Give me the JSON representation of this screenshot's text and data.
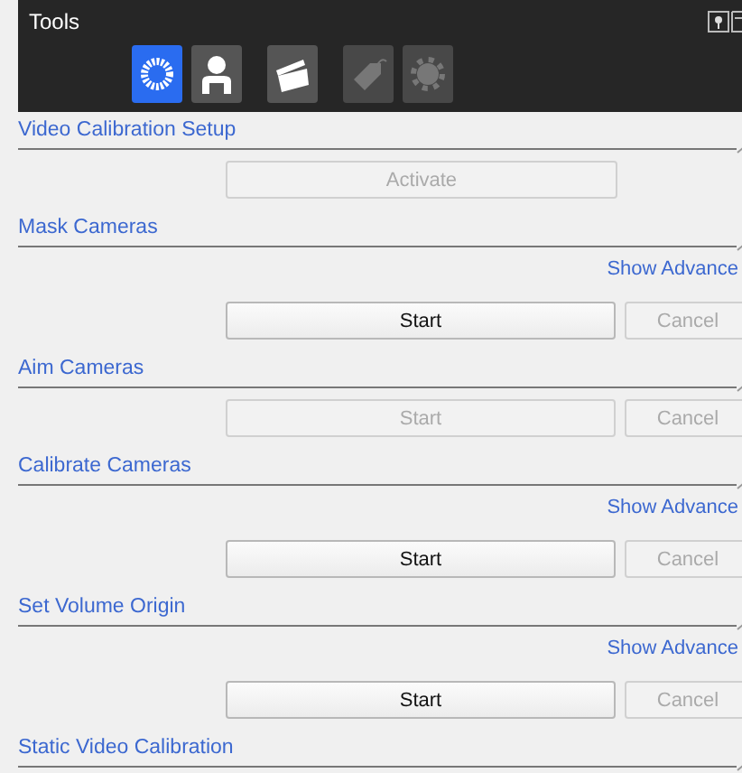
{
  "panel": {
    "title": "Tools"
  },
  "tools": [
    {
      "kind": "ring",
      "selected": true,
      "disabled": false
    },
    {
      "kind": "person",
      "selected": false,
      "disabled": false
    },
    {
      "kind": "clapper",
      "selected": false,
      "disabled": false
    },
    {
      "kind": "tag",
      "selected": false,
      "disabled": true
    },
    {
      "kind": "gear",
      "selected": false,
      "disabled": true
    }
  ],
  "sections": [
    {
      "title": "Video Calibration Setup",
      "buttons": [
        {
          "label": "Activate",
          "disabled": true,
          "kind": "wide"
        }
      ]
    },
    {
      "title": "Mask Cameras",
      "show_advanced": "Show Advance",
      "buttons": [
        {
          "label": "Start",
          "disabled": false,
          "kind": "main"
        },
        {
          "label": "Cancel",
          "disabled": true,
          "kind": "side"
        }
      ]
    },
    {
      "title": "Aim Cameras",
      "buttons": [
        {
          "label": "Start",
          "disabled": true,
          "kind": "main"
        },
        {
          "label": "Cancel",
          "disabled": true,
          "kind": "side"
        }
      ]
    },
    {
      "title": "Calibrate Cameras",
      "show_advanced": "Show Advance",
      "buttons": [
        {
          "label": "Start",
          "disabled": false,
          "kind": "main"
        },
        {
          "label": "Cancel",
          "disabled": true,
          "kind": "side"
        }
      ]
    },
    {
      "title": "Set Volume Origin",
      "show_advanced": "Show Advance",
      "buttons": [
        {
          "label": "Start",
          "disabled": false,
          "kind": "main"
        },
        {
          "label": "Cancel",
          "disabled": true,
          "kind": "side"
        }
      ]
    },
    {
      "title": "Static Video Calibration"
    }
  ]
}
